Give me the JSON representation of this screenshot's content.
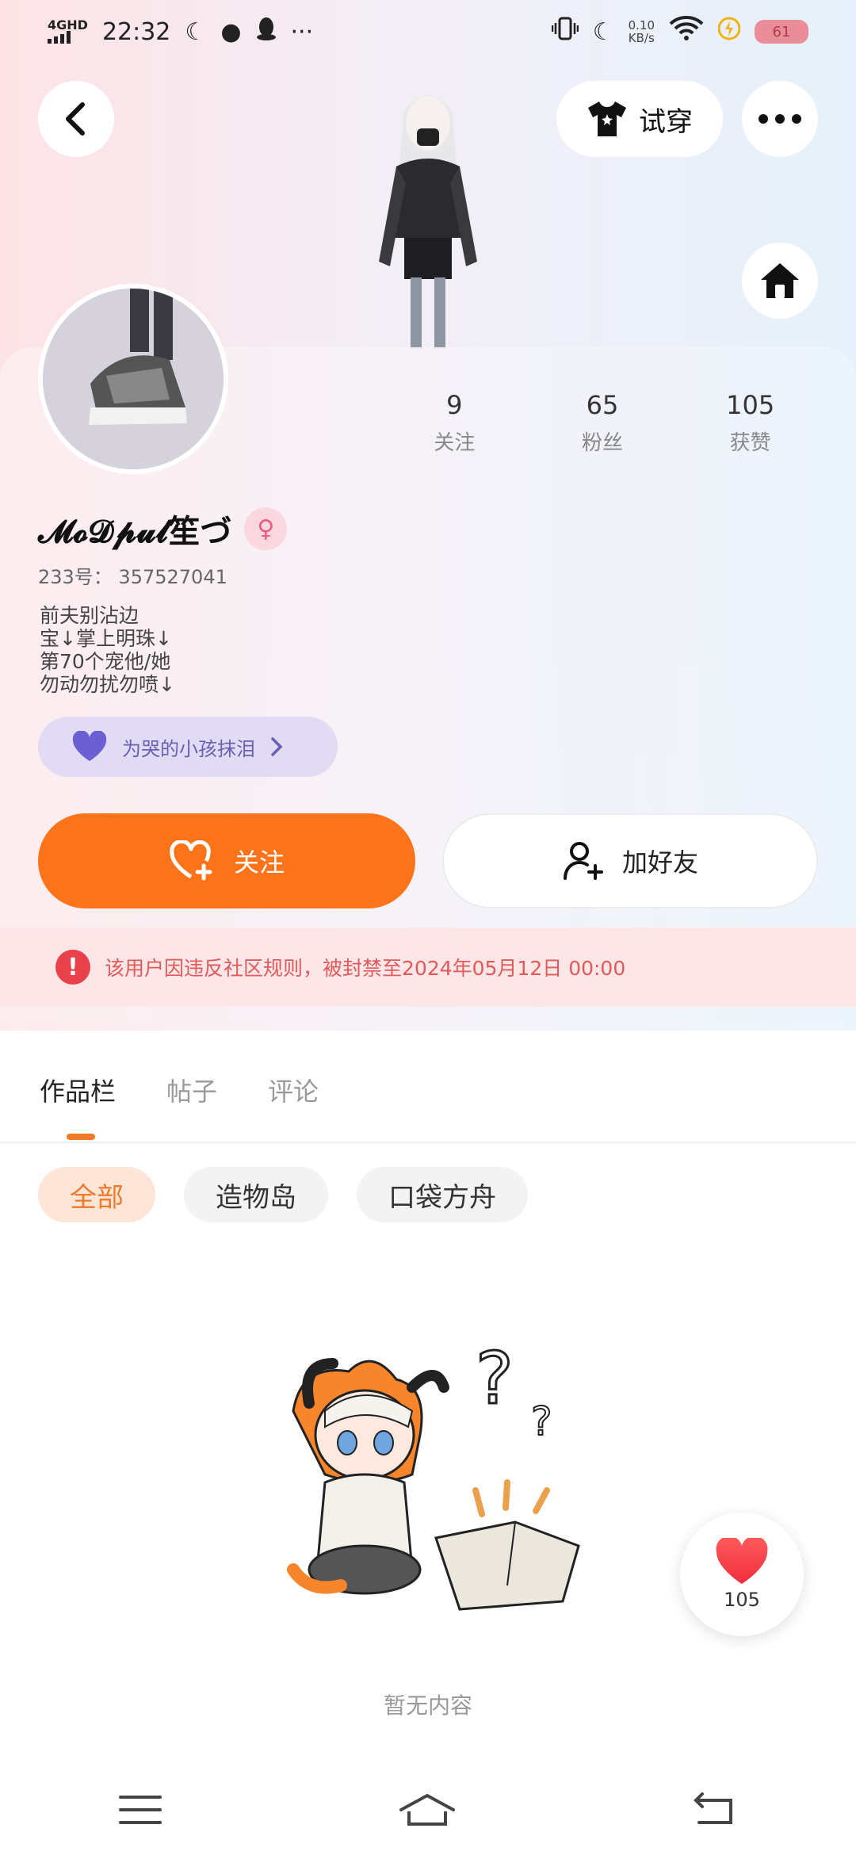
{
  "status_bar": {
    "network": "4GHD",
    "time": "22:32",
    "speed": "0.10\nKB/s",
    "battery": "61"
  },
  "header": {
    "try_on_label": "试穿"
  },
  "profile": {
    "stats": [
      {
        "value": "9",
        "label": "关注"
      },
      {
        "value": "65",
        "label": "粉丝"
      },
      {
        "value": "105",
        "label": "获赞"
      }
    ],
    "username": "𝓜𝓸𝓓𝓹𝓾𝓵笙づ",
    "gender_symbol": "♀",
    "uid": "233号： 357527041",
    "bio": "前夫别沾边\n宝↓掌上明珠↓\n第70个宠他/她\n勿动勿扰勿喷↓",
    "medal_label": "为哭的小孩抹泪"
  },
  "actions": {
    "follow_label": "关注",
    "add_friend_label": "加好友"
  },
  "ban_notice": "该用户因违反社区规则，被封禁至2024年05月12日 00:00",
  "tabs": [
    {
      "label": "作品栏",
      "active": true
    },
    {
      "label": "帖子",
      "active": false
    },
    {
      "label": "评论",
      "active": false
    }
  ],
  "filters": [
    {
      "label": "全部",
      "active": true
    },
    {
      "label": "造物岛",
      "active": false
    },
    {
      "label": "口袋方舟",
      "active": false
    }
  ],
  "empty_text": "暂无内容",
  "like_count": "105",
  "colors": {
    "accent": "#fd7319",
    "ban_text": "#e15a5a",
    "medal": "#6a5fb5"
  }
}
